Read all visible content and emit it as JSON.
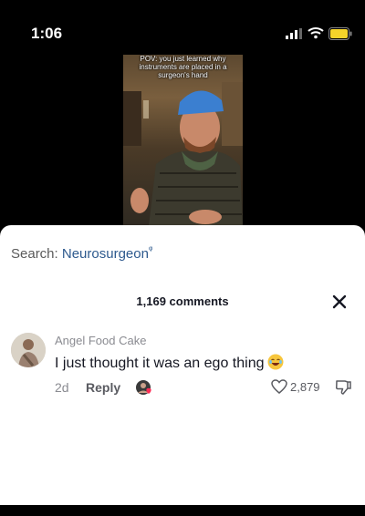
{
  "status_bar": {
    "time": "1:06"
  },
  "video": {
    "caption": "POV: you just learned why instruments are placed in a surgeon's hand"
  },
  "search": {
    "label": "Search: ",
    "term": "Neurosurgeon",
    "glyph": "ᵠ"
  },
  "comments": {
    "count_label": "1,169 comments",
    "items": [
      {
        "username": "Angel Food Cake",
        "text": "I just thought it was an ego thing",
        "age": "2d",
        "reply_label": "Reply",
        "likes": "2,879"
      }
    ]
  },
  "colors": {
    "link": "#2e5a8e",
    "text": "#161823",
    "muted": "#8a8b91"
  }
}
